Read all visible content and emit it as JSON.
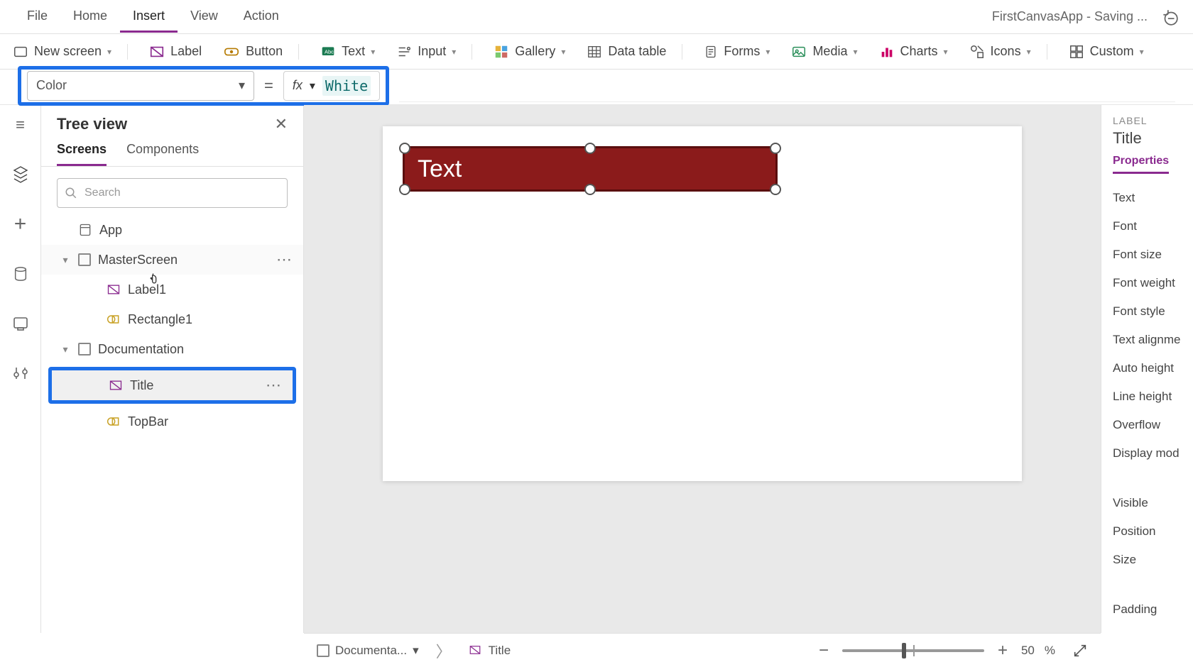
{
  "menu": {
    "file": "File",
    "home": "Home",
    "insert": "Insert",
    "view": "View",
    "action": "Action",
    "app_title": "FirstCanvasApp - Saving ..."
  },
  "ribbon": {
    "new_screen": "New screen",
    "label": "Label",
    "button": "Button",
    "text": "Text",
    "input": "Input",
    "gallery": "Gallery",
    "data_table": "Data table",
    "forms": "Forms",
    "media": "Media",
    "charts": "Charts",
    "icons": "Icons",
    "custom": "Custom"
  },
  "formula": {
    "property": "Color",
    "value": "White"
  },
  "treeview": {
    "title": "Tree view",
    "tab_screens": "Screens",
    "tab_components": "Components",
    "search_placeholder": "Search",
    "app": "App",
    "master": "MasterScreen",
    "label1": "Label1",
    "rect1": "Rectangle1",
    "doc": "Documentation",
    "title_item": "Title",
    "topbar": "TopBar"
  },
  "canvas": {
    "control_text": "Text"
  },
  "proppanel": {
    "type": "LABEL",
    "name": "Title",
    "tab": "Properties",
    "rows": [
      "Text",
      "Font",
      "Font size",
      "Font weight",
      "Font style",
      "Text alignme",
      "Auto height",
      "Line height",
      "Overflow",
      "Display mod"
    ],
    "rows2": [
      "Visible",
      "Position",
      "Size",
      "Padding"
    ]
  },
  "statusbar": {
    "screen": "Documenta...",
    "control": "Title",
    "zoom": "50",
    "zoom_unit": "%"
  }
}
